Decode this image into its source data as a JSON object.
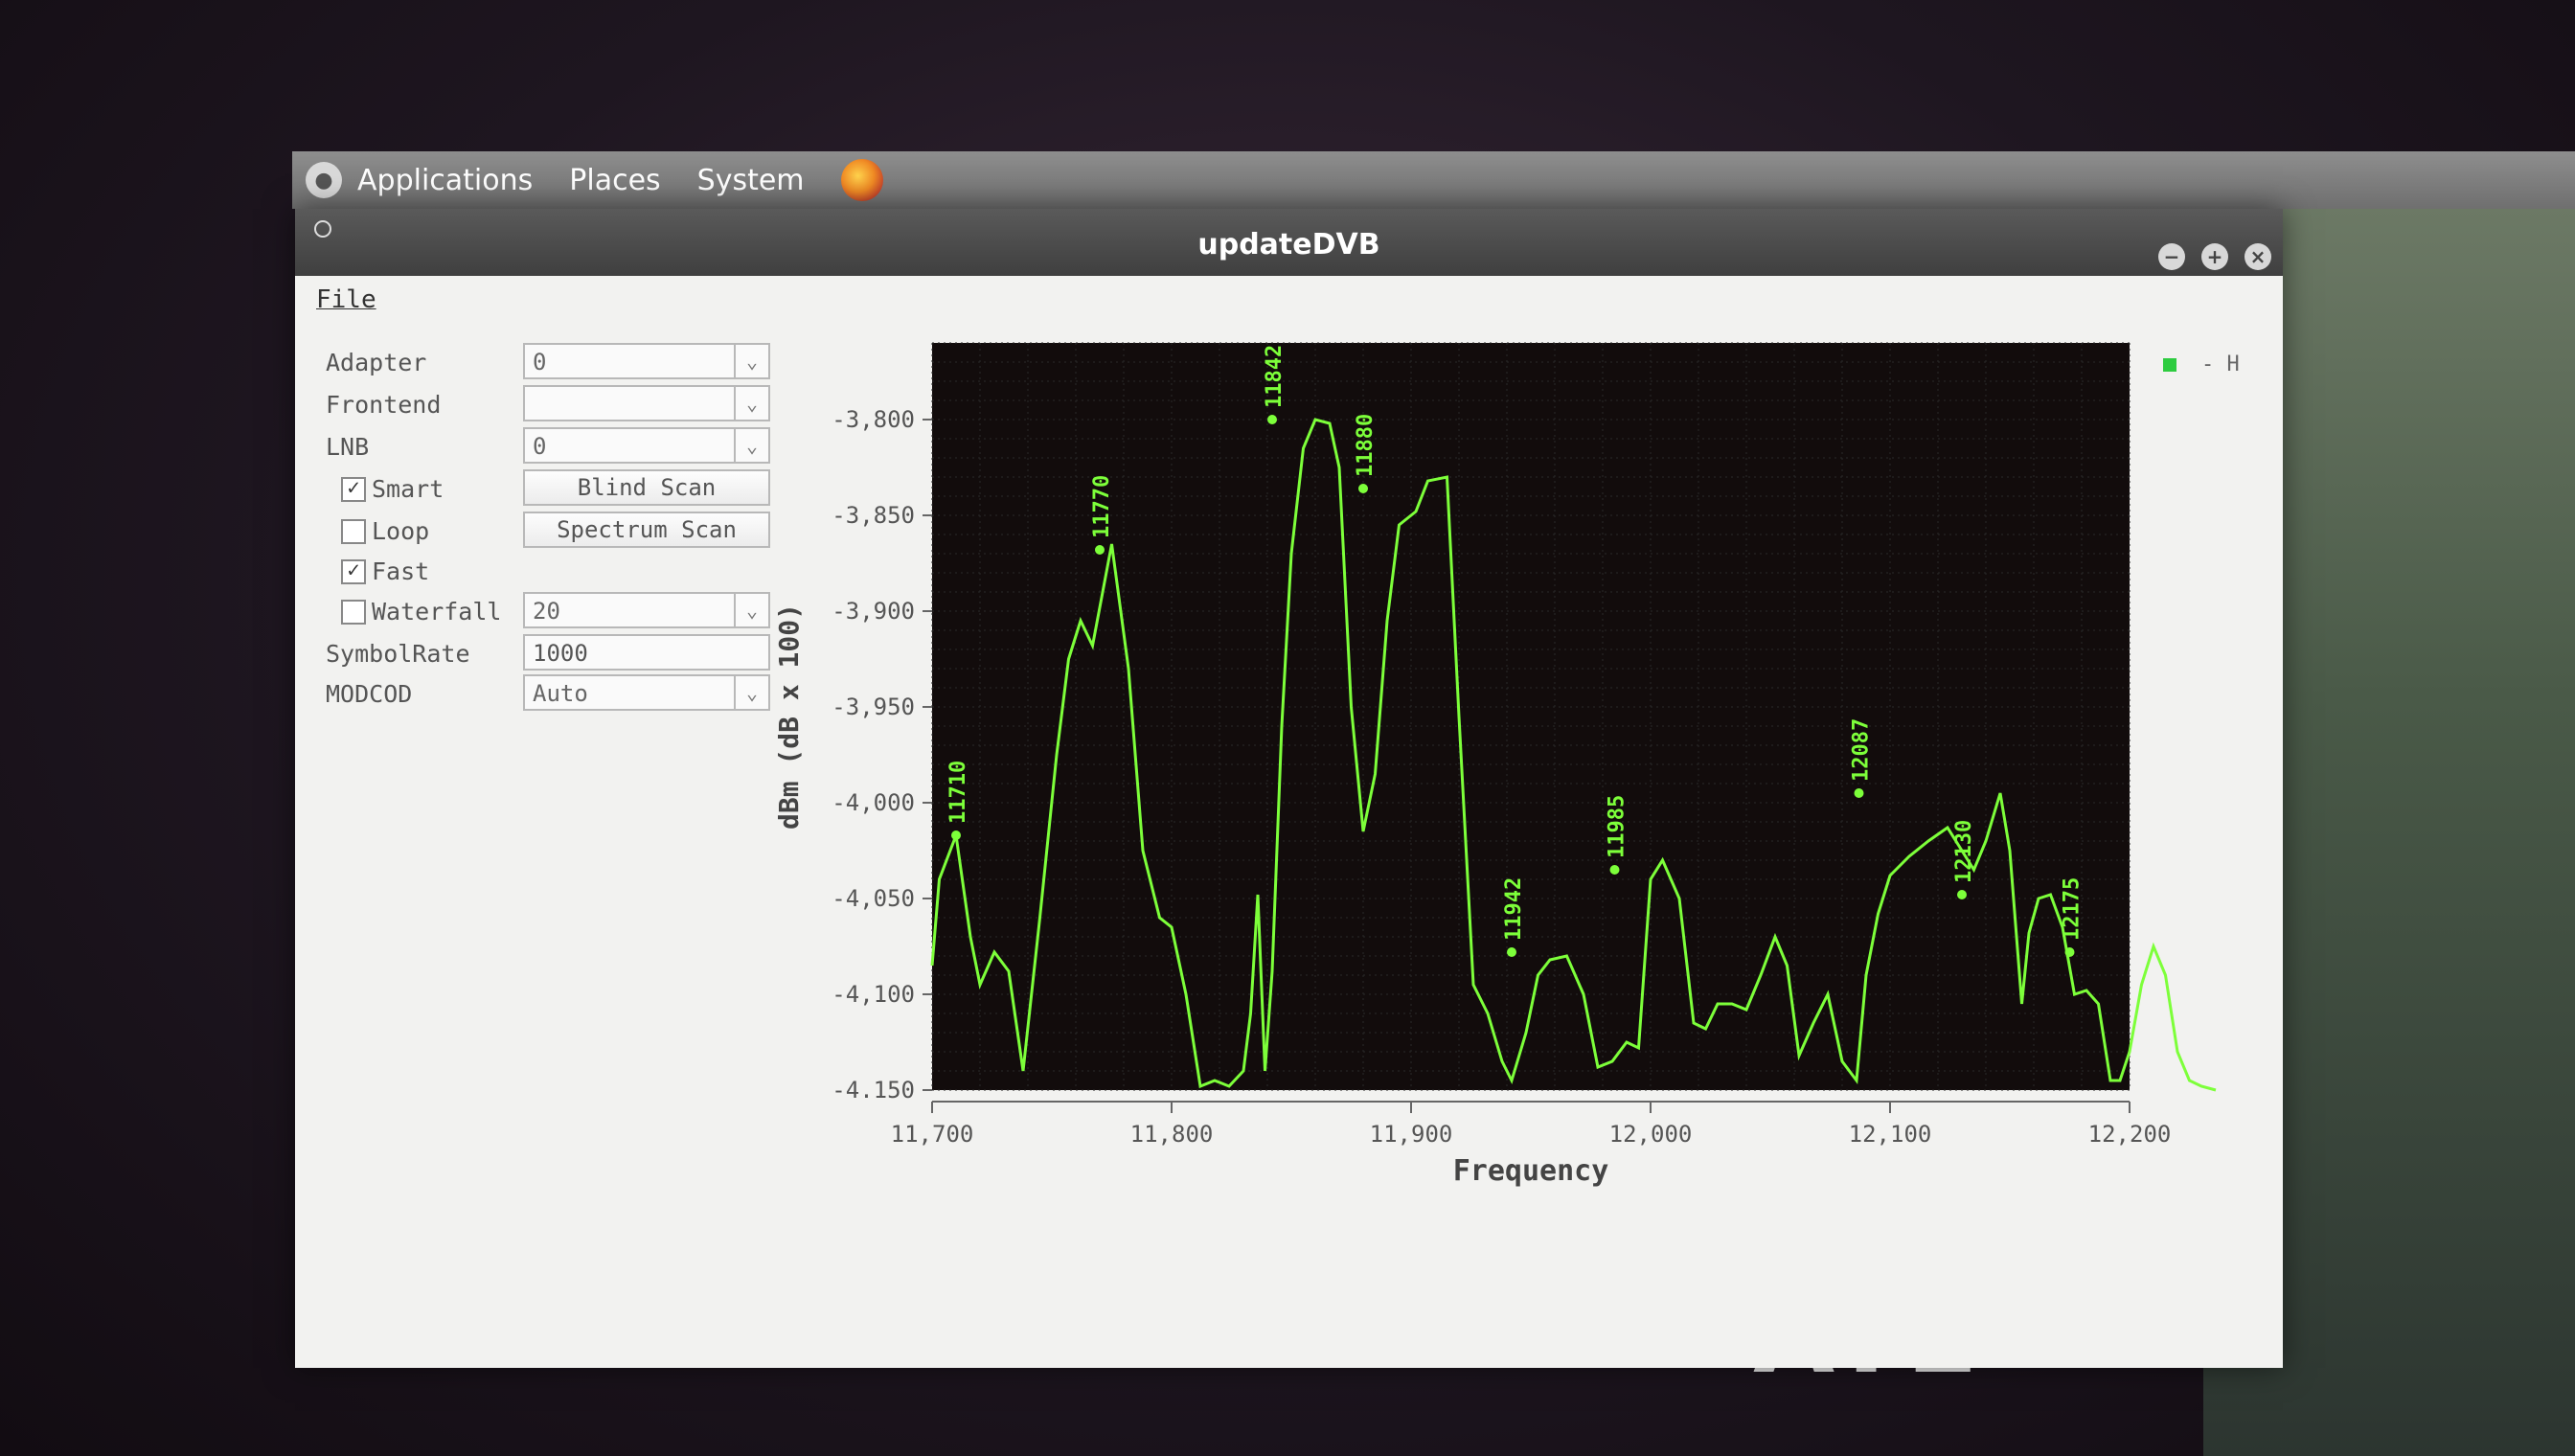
{
  "panel": {
    "menus": [
      "Applications",
      "Places",
      "System"
    ]
  },
  "window": {
    "title": "updateDVB",
    "menu_file": "File"
  },
  "controls": {
    "adapter": {
      "label": "Adapter",
      "value": "0"
    },
    "frontend": {
      "label": "Frontend",
      "value": ""
    },
    "lnb": {
      "label": "LNB",
      "value": "0"
    },
    "smart": {
      "label": "Smart",
      "checked": true
    },
    "loop": {
      "label": "Loop",
      "checked": false
    },
    "fast": {
      "label": "Fast",
      "checked": true
    },
    "waterfall": {
      "label": "Waterfall",
      "checked": false,
      "value": "20"
    },
    "symbolrate": {
      "label": "SymbolRate",
      "value": "1000"
    },
    "modcod": {
      "label": "MODCOD",
      "value": "Auto"
    },
    "blind_scan": "Blind Scan",
    "spectrum_scan": "Spectrum Scan"
  },
  "desktop": {
    "logo_text": "ATE"
  },
  "chart_data": {
    "type": "line",
    "xlabel": "Frequency",
    "ylabel": "dBm (dB x 100)",
    "xlim": [
      11700,
      12200
    ],
    "ylim": [
      -4150,
      -3760
    ],
    "x_ticks": [
      "11,700",
      "11,800",
      "11,900",
      "12,000",
      "12,100",
      "12,200"
    ],
    "y_ticks": [
      "-3,800",
      "-3,850",
      "-3,900",
      "-3,950",
      "-4,000",
      "-4,050",
      "-4,100",
      "-4.150"
    ],
    "legend": {
      "entries": [
        "- H"
      ],
      "placement": "top-right"
    },
    "line_color": "#7dff3a",
    "plot_background": "#120c0c",
    "series": [
      {
        "name": "H",
        "points": [
          [
            11700,
            -4085
          ],
          [
            11703,
            -4040
          ],
          [
            11710,
            -4017
          ],
          [
            11716,
            -4070
          ],
          [
            11720,
            -4095
          ],
          [
            11726,
            -4078
          ],
          [
            11732,
            -4088
          ],
          [
            11738,
            -4140
          ],
          [
            11745,
            -4060
          ],
          [
            11752,
            -3975
          ],
          [
            11757,
            -3925
          ],
          [
            11762,
            -3905
          ],
          [
            11767,
            -3918
          ],
          [
            11775,
            -3865
          ],
          [
            11782,
            -3930
          ],
          [
            11788,
            -4025
          ],
          [
            11795,
            -4060
          ],
          [
            11800,
            -4065
          ],
          [
            11806,
            -4100
          ],
          [
            11812,
            -4148
          ],
          [
            11818,
            -4145
          ],
          [
            11824,
            -4148
          ],
          [
            11830,
            -4140
          ],
          [
            11833,
            -4110
          ],
          [
            11836,
            -4048
          ],
          [
            11839,
            -4140
          ],
          [
            11842,
            -4088
          ],
          [
            11846,
            -3960
          ],
          [
            11850,
            -3870
          ],
          [
            11855,
            -3815
          ],
          [
            11860,
            -3800
          ],
          [
            11866,
            -3802
          ],
          [
            11870,
            -3825
          ],
          [
            11875,
            -3950
          ],
          [
            11880,
            -4015
          ],
          [
            11885,
            -3985
          ],
          [
            11890,
            -3905
          ],
          [
            11895,
            -3855
          ],
          [
            11902,
            -3848
          ],
          [
            11907,
            -3832
          ],
          [
            11915,
            -3830
          ],
          [
            11920,
            -3955
          ],
          [
            11926,
            -4095
          ],
          [
            11932,
            -4110
          ],
          [
            11938,
            -4135
          ],
          [
            11942,
            -4145
          ],
          [
            11948,
            -4120
          ],
          [
            11953,
            -4090
          ],
          [
            11958,
            -4082
          ],
          [
            11965,
            -4080
          ],
          [
            11972,
            -4100
          ],
          [
            11978,
            -4138
          ],
          [
            11984,
            -4135
          ],
          [
            11990,
            -4125
          ],
          [
            11995,
            -4128
          ],
          [
            12000,
            -4040
          ],
          [
            12005,
            -4030
          ],
          [
            12012,
            -4050
          ],
          [
            12018,
            -4115
          ],
          [
            12023,
            -4118
          ],
          [
            12028,
            -4105
          ],
          [
            12034,
            -4105
          ],
          [
            12040,
            -4108
          ],
          [
            12046,
            -4090
          ],
          [
            12052,
            -4070
          ],
          [
            12057,
            -4085
          ],
          [
            12062,
            -4132
          ],
          [
            12068,
            -4115
          ],
          [
            12074,
            -4100
          ],
          [
            12080,
            -4135
          ],
          [
            12086,
            -4145
          ],
          [
            12090,
            -4090
          ],
          [
            12095,
            -4058
          ],
          [
            12100,
            -4038
          ],
          [
            12108,
            -4028
          ],
          [
            12116,
            -4020
          ],
          [
            12124,
            -4013
          ],
          [
            12130,
            -4025
          ],
          [
            12135,
            -4035
          ],
          [
            12140,
            -4020
          ],
          [
            12146,
            -3995
          ],
          [
            12150,
            -4025
          ],
          [
            12155,
            -4105
          ],
          [
            12158,
            -4068
          ],
          [
            12162,
            -4050
          ],
          [
            12167,
            -4048
          ],
          [
            12172,
            -4065
          ],
          [
            12177,
            -4100
          ],
          [
            12182,
            -4098
          ],
          [
            12187,
            -4105
          ],
          [
            12192,
            -4145
          ],
          [
            12196,
            -4145
          ],
          [
            12200,
            -4130
          ],
          [
            12205,
            -4095
          ],
          [
            12210,
            -4075
          ],
          [
            12215,
            -4090
          ],
          [
            12220,
            -4130
          ],
          [
            12225,
            -4145
          ],
          [
            12230,
            -4148
          ],
          [
            12236,
            -4150
          ]
        ]
      }
    ],
    "annotations": [
      {
        "x": 11710,
        "y": -4017,
        "label": "11710"
      },
      {
        "x": 11770,
        "y": -3868,
        "label": "11770"
      },
      {
        "x": 11842,
        "y": -3800,
        "label": "11842"
      },
      {
        "x": 11880,
        "y": -3836,
        "label": "11880"
      },
      {
        "x": 11942,
        "y": -4078,
        "label": "11942"
      },
      {
        "x": 11985,
        "y": -4035,
        "label": "11985"
      },
      {
        "x": 12087,
        "y": -3995,
        "label": "12087"
      },
      {
        "x": 12130,
        "y": -4048,
        "label": "12130"
      },
      {
        "x": 12175,
        "y": -4078,
        "label": "12175"
      }
    ]
  }
}
